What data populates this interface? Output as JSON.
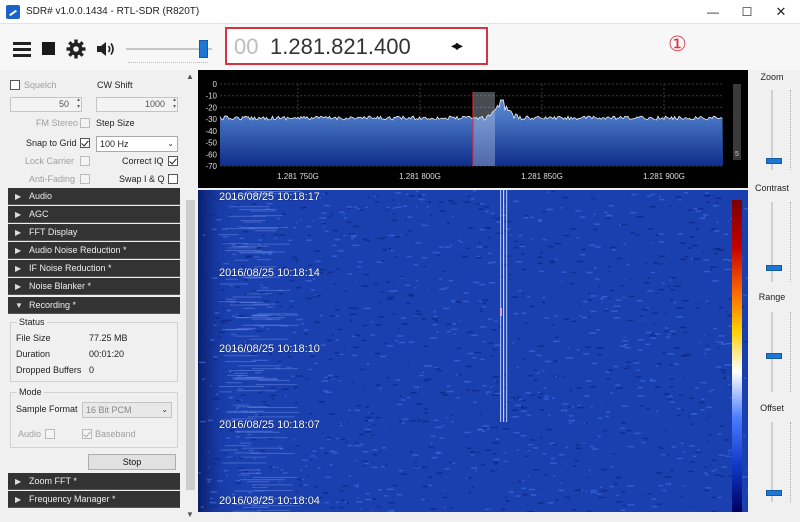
{
  "window": {
    "title": "SDR# v1.0.0.1434 - RTL-SDR (R820T)",
    "minimize": "—",
    "maximize": "☐",
    "close": "✕"
  },
  "toolbar": {
    "icons": [
      "menu-icon",
      "stop-icon",
      "gear-icon",
      "speaker-icon"
    ],
    "volume_fraction": 0.9,
    "frequency_leading": "00",
    "frequency_main": "1.281.821.400",
    "frequency_arrows": "◂▸",
    "annotation": "①"
  },
  "left_panel": {
    "squelch_label": "Squelch",
    "cw_shift_label": "CW Shift",
    "squelch_value": "50",
    "cw_shift_value": "1000",
    "fm_stereo_label": "FM Stereo",
    "step_size_label": "Step Size",
    "snap_to_grid_label": "Snap to Grid",
    "snap_to_grid_checked": true,
    "step_size_value": "100 Hz",
    "lock_carrier_label": "Lock Carrier",
    "correct_iq_label": "Correct IQ",
    "correct_iq_checked": true,
    "anti_fading_label": "Anti-Fading",
    "swap_iq_label": "Swap I & Q",
    "sections": [
      {
        "label": "Audio",
        "expanded": false
      },
      {
        "label": "AGC",
        "expanded": false
      },
      {
        "label": "FFT Display",
        "expanded": false
      },
      {
        "label": "Audio Noise Reduction *",
        "expanded": false
      },
      {
        "label": "IF Noise Reduction *",
        "expanded": false
      },
      {
        "label": "Noise Blanker *",
        "expanded": false
      },
      {
        "label": "Recording *",
        "expanded": true
      }
    ],
    "recording": {
      "status_title": "Status",
      "file_size_label": "File Size",
      "file_size_value": "77.25 MB",
      "duration_label": "Duration",
      "duration_value": "00:01:20",
      "dropped_buffers_label": "Dropped Buffers",
      "dropped_buffers_value": "0",
      "mode_title": "Mode",
      "sample_format_label": "Sample Format",
      "sample_format_value": "16 Bit PCM",
      "audio_label": "Audio",
      "baseband_label": "Baseband",
      "baseband_checked": true,
      "stop_button": "Stop"
    },
    "bottom_sections": [
      {
        "label": "Zoom FFT *"
      },
      {
        "label": "Frequency Manager *"
      }
    ]
  },
  "spectrum": {
    "y_ticks": [
      "0",
      "-10",
      "-20",
      "-30",
      "-40",
      "-50",
      "-60",
      "-70"
    ],
    "x_ticks": [
      "1.281 750G",
      "1.281 800G",
      "1.281 850G",
      "1.281 900G"
    ],
    "scroll_label": "5",
    "colors": {
      "trace": "#ffffff",
      "fill_top": "#5d8ed8",
      "fill_bottom": "#0f2e8a",
      "marker": "#ff2020"
    }
  },
  "waterfall": {
    "timestamps": [
      "2016/08/25 10:18:17",
      "2016/08/25 10:18:14",
      "2016/08/25 10:18:10",
      "2016/08/25 10:18:07",
      "2016/08/25 10:18:04"
    ]
  },
  "right_panel": {
    "zoom_label": "Zoom",
    "contrast_label": "Contrast",
    "range_label": "Range",
    "offset_label": "Offset",
    "zoom_level": 0.92,
    "contrast_level": 0.85,
    "range_level": 0.55,
    "offset_level": 0.92
  }
}
